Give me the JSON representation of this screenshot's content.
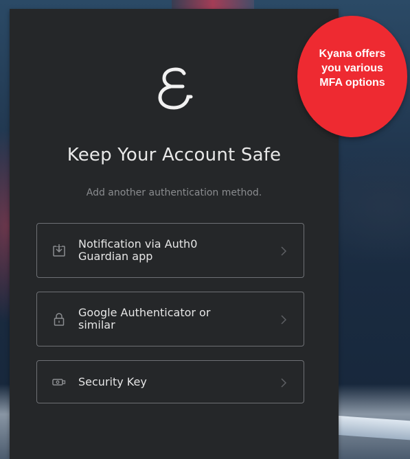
{
  "panel": {
    "title": "Keep Your Account Safe",
    "subtitle": "Add another authentication method."
  },
  "options": [
    {
      "label_line1": "Notification via Auth0",
      "label_line2": "Guardian app",
      "icon": "download-to-phone-icon"
    },
    {
      "label_line1": "Google Authenticator or",
      "label_line2": "similar",
      "icon": "lock-icon"
    },
    {
      "label_line1": "Security Key",
      "label_line2": "",
      "icon": "security-key-icon"
    }
  ],
  "callout": {
    "lines": [
      "Kyana offers",
      "you various",
      "MFA options"
    ]
  },
  "colors": {
    "panel_bg": "#252729",
    "callout_red": "#ee2a31",
    "border": "#6f7175"
  }
}
